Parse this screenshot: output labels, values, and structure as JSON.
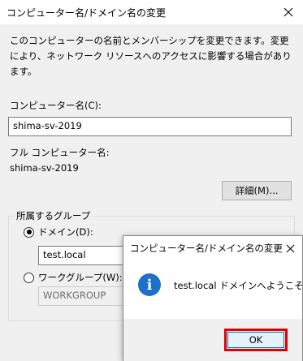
{
  "main_dialog": {
    "title": "コンピューター名/ドメイン名の変更",
    "description": "このコンピューターの名前とメンバーシップを変更できます。変更により、ネットワーク リソースへのアクセスに影響する場合があります。",
    "computer_name_label": "コンピューター名(C):",
    "computer_name_value": "shima-sv-2019",
    "full_name_label": "フル コンピューター名:",
    "full_name_value": "shima-sv-2019",
    "details_button": "詳細(M)...",
    "member_group": {
      "legend": "所属するグループ",
      "domain_label": "ドメイン(D):",
      "domain_value": "test.local",
      "domain_selected": true,
      "workgroup_label": "ワークグループ(W):",
      "workgroup_value": "WORKGROUP",
      "workgroup_selected": false
    }
  },
  "message_box": {
    "title": "コンピューター名/ドメイン名の変更",
    "icon": "info-icon",
    "message": "test.local ドメインへようこそ。",
    "ok_button": "OK",
    "highlight_color": "#e00000"
  }
}
